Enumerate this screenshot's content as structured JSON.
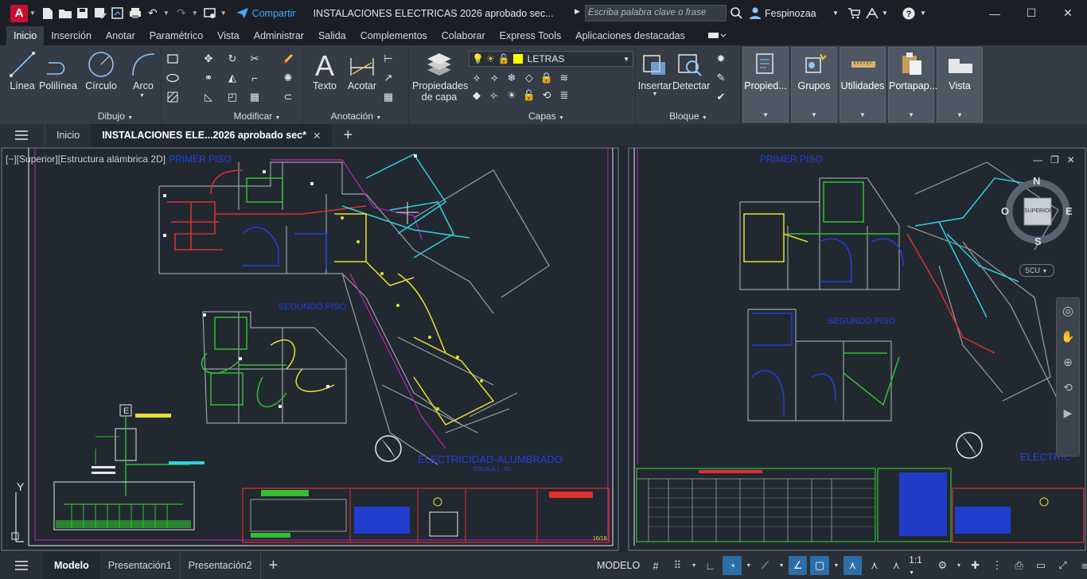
{
  "title_bar": {
    "logo": "A",
    "share": "Compartir",
    "document_title": "INSTALACIONES ELECTRICAS 2026 aprobado sec...",
    "search_placeholder": "Escriba palabra clave o frase",
    "user": "Fespinozaa"
  },
  "ribbon_tabs": [
    "Inicio",
    "Inserción",
    "Anotar",
    "Paramétrico",
    "Vista",
    "Administrar",
    "Salida",
    "Complementos",
    "Colaborar",
    "Express Tools",
    "Aplicaciones destacadas"
  ],
  "ribbon": {
    "dibujo": {
      "title": "Dibujo",
      "tools": [
        "Línea",
        "Polilínea",
        "Círculo",
        "Arco"
      ]
    },
    "modificar": {
      "title": "Modificar"
    },
    "anotacion": {
      "title": "Anotación",
      "tools": [
        "Texto",
        "Acotar"
      ]
    },
    "capas": {
      "title": "Capas",
      "tool": "Propiedades de capa",
      "current_layer": "LETRAS",
      "layer_color": "#ffff00"
    },
    "bloque": {
      "title": "Bloque",
      "tools": [
        "Insertar",
        "Detectar"
      ]
    },
    "grey_panels": [
      "Propied...",
      "Grupos",
      "Utilidades",
      "Portapap...",
      "Vista"
    ]
  },
  "doc_tabs": {
    "start": "Inicio",
    "active": "INSTALACIONES ELE...2026 aprobado sec*"
  },
  "viewport": {
    "label": "[−][Superior][Estructura alámbrica 2D]",
    "left_texts": {
      "primer": "PRIMER PISO",
      "segundo": "SEGUNDO PISO",
      "title": "ELECTRICIDAD-ALUMBRADO",
      "scale": "ESCALA 1 : 50"
    },
    "right_texts": {
      "primer": "PRIMER PISO",
      "segundo": "SEGUNDO PISO",
      "title": "ELECTRIC"
    },
    "viewcube": {
      "n": "N",
      "s": "S",
      "e": "E",
      "o": "O",
      "face": "SUPERIOR",
      "wcs": "SCU"
    },
    "axis_y": "Y",
    "sheet_no": "16/18"
  },
  "status": {
    "tabs": [
      "Modelo",
      "Presentación1",
      "Presentación2"
    ],
    "mode": "MODELO",
    "scale": "1:1"
  }
}
